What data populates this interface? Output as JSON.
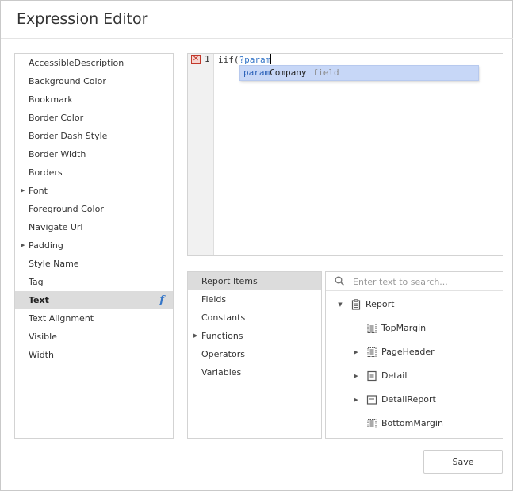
{
  "dialog": {
    "title": "Expression Editor"
  },
  "properties": [
    {
      "label": "AccessibleDescription",
      "expandable": false,
      "selected": false
    },
    {
      "label": "Background Color",
      "expandable": false,
      "selected": false
    },
    {
      "label": "Bookmark",
      "expandable": false,
      "selected": false
    },
    {
      "label": "Border Color",
      "expandable": false,
      "selected": false
    },
    {
      "label": "Border Dash Style",
      "expandable": false,
      "selected": false
    },
    {
      "label": "Border Width",
      "expandable": false,
      "selected": false
    },
    {
      "label": "Borders",
      "expandable": false,
      "selected": false
    },
    {
      "label": "Font",
      "expandable": true,
      "selected": false
    },
    {
      "label": "Foreground Color",
      "expandable": false,
      "selected": false
    },
    {
      "label": "Navigate Url",
      "expandable": false,
      "selected": false
    },
    {
      "label": "Padding",
      "expandable": true,
      "selected": false
    },
    {
      "label": "Style Name",
      "expandable": false,
      "selected": false
    },
    {
      "label": "Tag",
      "expandable": false,
      "selected": false
    },
    {
      "label": "Text",
      "expandable": false,
      "selected": true,
      "has_expression": true
    },
    {
      "label": "Text Alignment",
      "expandable": false,
      "selected": false
    },
    {
      "label": "Visible",
      "expandable": false,
      "selected": false
    },
    {
      "label": "Width",
      "expandable": false,
      "selected": false
    }
  ],
  "editor": {
    "line_number": "1",
    "code_prefix": "iif(",
    "code_param": "?param",
    "error_marker": "✕",
    "autocomplete": {
      "match": "param",
      "rest": "Company",
      "type": "field"
    }
  },
  "categories": [
    {
      "label": "Report Items",
      "expandable": false,
      "selected": true
    },
    {
      "label": "Fields",
      "expandable": false,
      "selected": false
    },
    {
      "label": "Constants",
      "expandable": false,
      "selected": false
    },
    {
      "label": "Functions",
      "expandable": true,
      "selected": false
    },
    {
      "label": "Operators",
      "expandable": false,
      "selected": false
    },
    {
      "label": "Variables",
      "expandable": false,
      "selected": false
    }
  ],
  "tree": {
    "search_placeholder": "Enter text to search...",
    "nodes": [
      {
        "label": "Report",
        "icon": "report-icon",
        "toggle": "expanded",
        "level": 0
      },
      {
        "label": "TopMargin",
        "icon": "band-icon",
        "toggle": "none",
        "level": 1
      },
      {
        "label": "PageHeader",
        "icon": "band-icon",
        "toggle": "collapsed",
        "level": 1
      },
      {
        "label": "Detail",
        "icon": "detail-icon",
        "toggle": "collapsed",
        "level": 1
      },
      {
        "label": "DetailReport",
        "icon": "detail-report-icon",
        "toggle": "collapsed",
        "level": 1
      },
      {
        "label": "BottomMargin",
        "icon": "band-icon",
        "toggle": "none",
        "level": 1
      }
    ]
  },
  "footer": {
    "save_label": "Save"
  },
  "colors": {
    "accent": "#3576c8",
    "selection": "#dcdcdc",
    "autocomplete_bg": "#c7d7f7",
    "error": "#c2382a"
  }
}
